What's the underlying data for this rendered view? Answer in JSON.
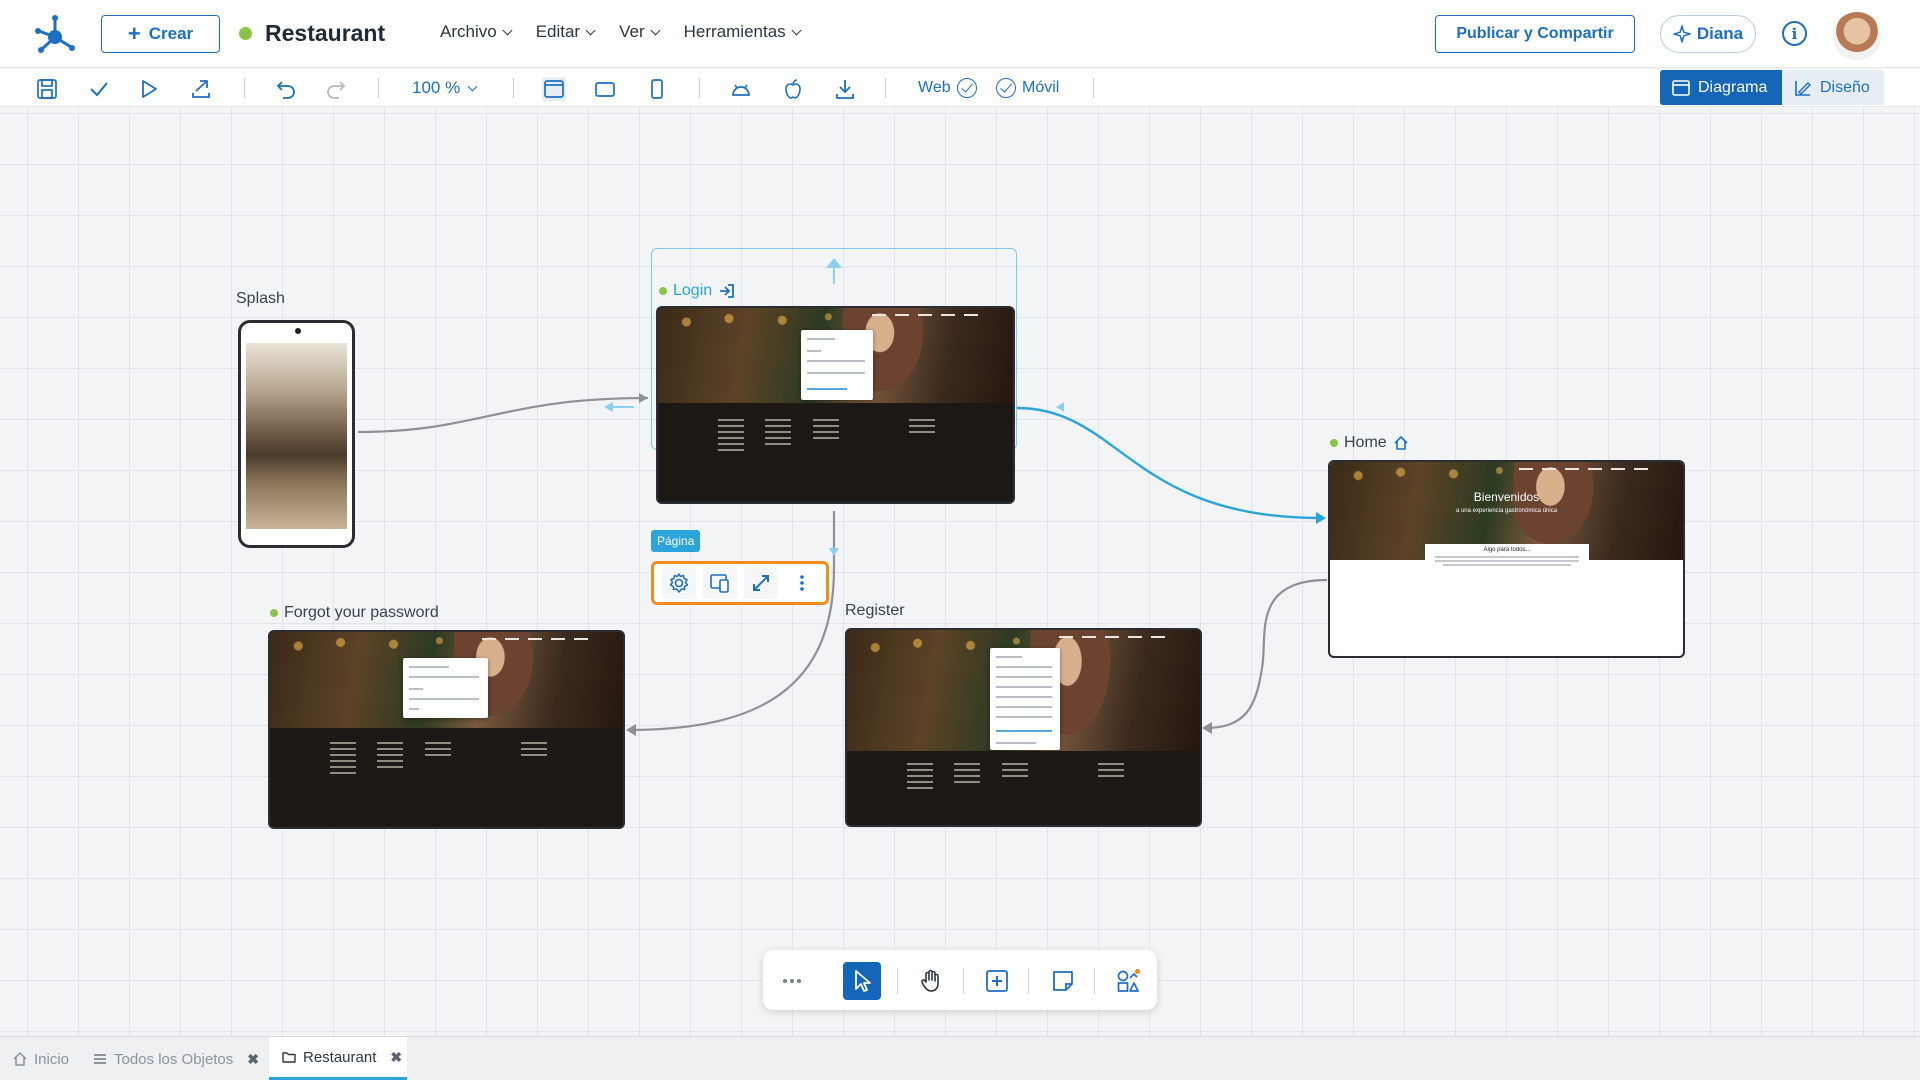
{
  "header": {
    "create_label": "Crear",
    "app_title": "Restaurant",
    "menu": [
      "Archivo",
      "Editar",
      "Ver",
      "Herramientas"
    ],
    "publish_label": "Publicar y Compartir",
    "assistant_label": "Diana",
    "info_glyph": "i"
  },
  "toolbar": {
    "zoom": "100 %",
    "web_label": "Web",
    "mobile_label": "Móvil",
    "view_diagram": "Diagrama",
    "view_design": "Diseño"
  },
  "nodes": {
    "splash": "Splash",
    "login": "Login",
    "forgot": "Forgot your password",
    "register": "Register",
    "home": "Home"
  },
  "home_preview": {
    "hero_title": "Bienvenidos",
    "hero_subtitle": "a una experiencia gastronómica única",
    "section_title": "Algo para todos..."
  },
  "page_tag": "Página",
  "tabs": [
    {
      "label": "Inicio",
      "closable": false
    },
    {
      "label": "Todos los Objetos",
      "closable": true
    },
    {
      "label": "Restaurant",
      "closable": true,
      "active": true
    }
  ],
  "colors": {
    "accent": "#1d6fc4",
    "selection": "#2aa4da",
    "status_green": "#8bc34a",
    "highlight": "#f08c1e"
  }
}
